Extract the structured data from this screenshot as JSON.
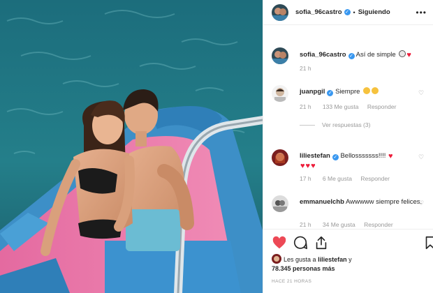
{
  "post": {
    "author": "sofia_96castro",
    "follow_dot": "•",
    "follow_status": "Siguiendo",
    "more_icon": "ellipsis-icon",
    "caption": {
      "user": "sofia_96castro",
      "text": "Así de simple",
      "time": "21 h"
    }
  },
  "comments": [
    {
      "user": "juanpgil",
      "verified": true,
      "text": "Siempre",
      "time": "21 h",
      "likes": "133 Me gusta",
      "reply": "Responder",
      "view_replies": "Ver respuestas (3)"
    },
    {
      "user": "liliestefan",
      "verified": true,
      "text": "Bellosssssss!!!!",
      "time": "17 h",
      "likes": "6 Me gusta",
      "reply": "Responder"
    },
    {
      "user": "emmanuelchb",
      "verified": false,
      "text": "Awwwww siempre felices.",
      "time": "21 h",
      "likes": "34 Me gusta",
      "reply": "Responder"
    }
  ],
  "actions": {
    "like_icon": "heart-icon",
    "comment_icon": "comment-icon",
    "share_icon": "share-icon",
    "save_icon": "bookmark-icon"
  },
  "likes": {
    "prefix": "Les gusta a",
    "user": "liliestefan",
    "conj": "y",
    "count": "78.345 personas más"
  },
  "timestamp": "HACE 21 HORAS",
  "colors": {
    "accent_blue": "#3897f0",
    "like_red": "#ed4956",
    "muted": "#999999",
    "sea": "#1f6f7d"
  }
}
